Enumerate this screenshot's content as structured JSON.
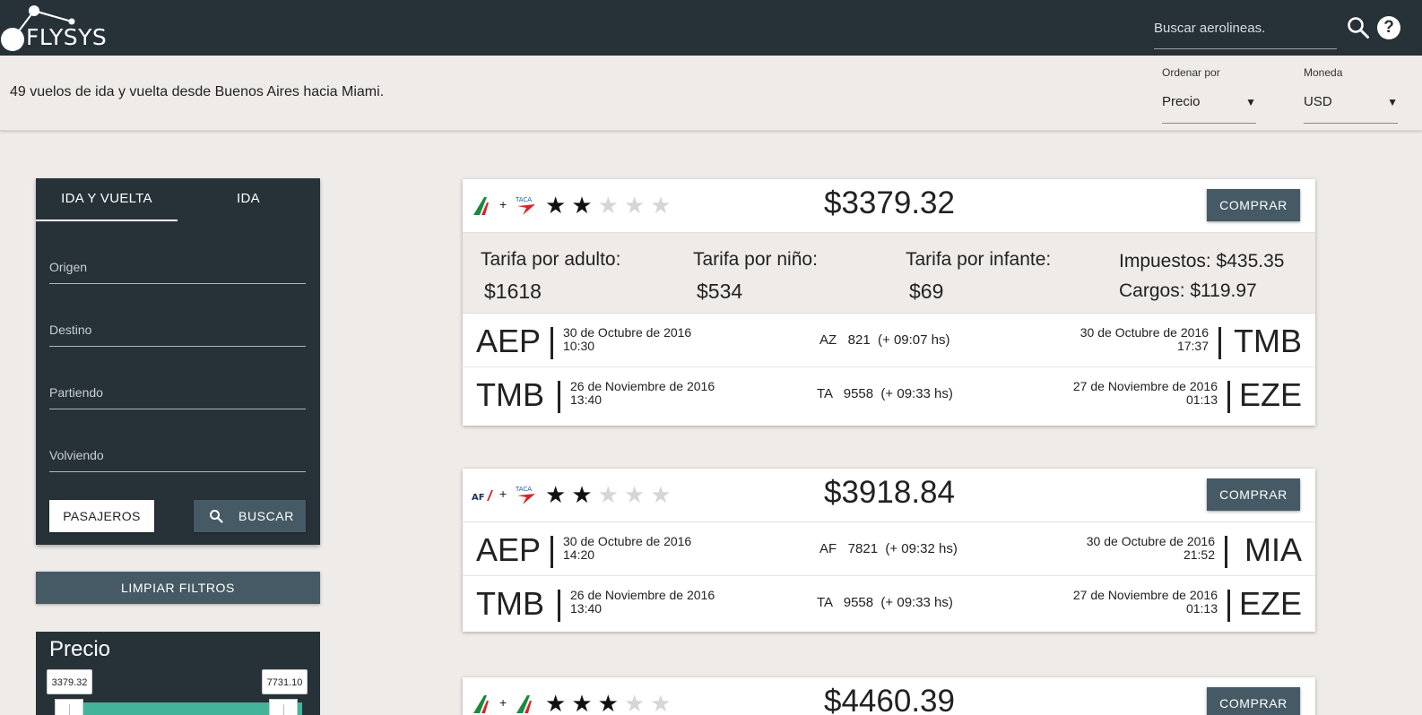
{
  "header": {
    "logo_text": "FLYSYS",
    "search_placeholder": "Buscar aerolineas.",
    "icons": [
      "search-icon",
      "help-icon"
    ],
    "help_symbol": "?"
  },
  "summary": {
    "text": "49 vuelos de ida y vuelta desde Buenos Aires hacia Miami.",
    "order_label": "Ordenar por",
    "order_value": "Precio",
    "currency_label": "Moneda",
    "currency_value": "USD",
    "arrow": "▼"
  },
  "search_form": {
    "tabs": [
      "IDA Y VUELTA",
      "IDA"
    ],
    "fields": [
      "Origen",
      "Destino",
      "Partiendo",
      "Volviendo"
    ],
    "passengers_button": "PASAJEROS",
    "search_button": "BUSCAR"
  },
  "clear_filters": "LIMPIAR FILTROS",
  "price_filter": {
    "title": "Precio",
    "min": "3379.32",
    "max": "7731.10"
  },
  "colors": {
    "topbar": "#263238",
    "button": "#455a64",
    "background": "#efebe8",
    "slider": "#43b49a"
  },
  "flights": [
    {
      "airline_logos": [
        "alitalia-logo",
        "taca-logo"
      ],
      "rating": 2,
      "price": "$3379.32",
      "buy_label": "COMPRAR",
      "fares": {
        "adult_label": "Tarifa por adulto:",
        "adult_value": "$1618",
        "child_label": "Tarifa por niño:",
        "child_value": "$534",
        "infant_label": "Tarifa por infante:",
        "infant_value": "$69",
        "taxes": "Impuestos: $435.35",
        "charges": "Cargos: $119.97"
      },
      "legs": [
        {
          "from": "AEP",
          "dep_date": "30 de Octubre de 2016",
          "dep_time": "10:30",
          "flight": "AZ   821  (+ 09:07 hs)",
          "arr_date": "30 de Octubre de 2016",
          "arr_time": "17:37",
          "to": "TMB"
        },
        {
          "from": "TMB",
          "dep_date": "26 de Noviembre de 2016",
          "dep_time": "13:40",
          "flight": "TA   9558  (+ 09:33 hs)",
          "arr_date": "27 de Noviembre de 2016",
          "arr_time": "01:13",
          "to": "EZE"
        }
      ]
    },
    {
      "airline_logos": [
        "airfrance-logo",
        "taca-logo"
      ],
      "rating": 2,
      "price": "$3918.84",
      "buy_label": "COMPRAR",
      "legs": [
        {
          "from": "AEP",
          "dep_date": "30 de Octubre de 2016",
          "dep_time": "14:20",
          "flight": "AF   7821  (+ 09:32 hs)",
          "arr_date": "30 de Octubre de 2016",
          "arr_time": "21:52",
          "to": "MIA"
        },
        {
          "from": "TMB",
          "dep_date": "26 de Noviembre de 2016",
          "dep_time": "13:40",
          "flight": "TA   9558  (+ 09:33 hs)",
          "arr_date": "27 de Noviembre de 2016",
          "arr_time": "01:13",
          "to": "EZE"
        }
      ]
    },
    {
      "airline_logos": [
        "alitalia-logo",
        "alitalia-logo"
      ],
      "rating": 3,
      "price": "$4460.39",
      "buy_label": "COMPRAR"
    }
  ],
  "stars": {
    "on": "★",
    "off": "★"
  }
}
